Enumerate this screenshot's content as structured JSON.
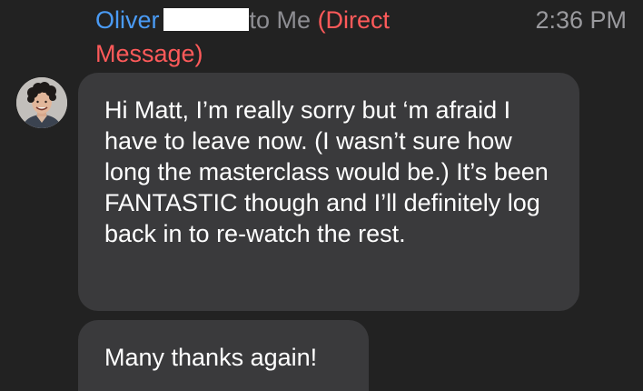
{
  "message": {
    "sender": "Oliver",
    "recipient_text": "to Me",
    "type_label": "(Direct",
    "type_label_cont": "Message)",
    "time": "2:36 PM"
  },
  "bubbles": [
    {
      "text": "Hi Matt, I’m really sorry but ‘m afraid I have to leave now. (I wasn’t sure how long the masterclass would be.) It’s been FANTASTIC though and I’ll definitely log back in to re-watch the rest."
    },
    {
      "text": "Many thanks again!"
    }
  ],
  "icons": {
    "avatar": "user-avatar-photo"
  },
  "colors": {
    "background": "#222222",
    "bubble": "#3a3a3c",
    "sender": "#4a9bf5",
    "direct_message": "#ff5a5a",
    "muted": "#8e8e93",
    "redaction": "#ffffff"
  }
}
